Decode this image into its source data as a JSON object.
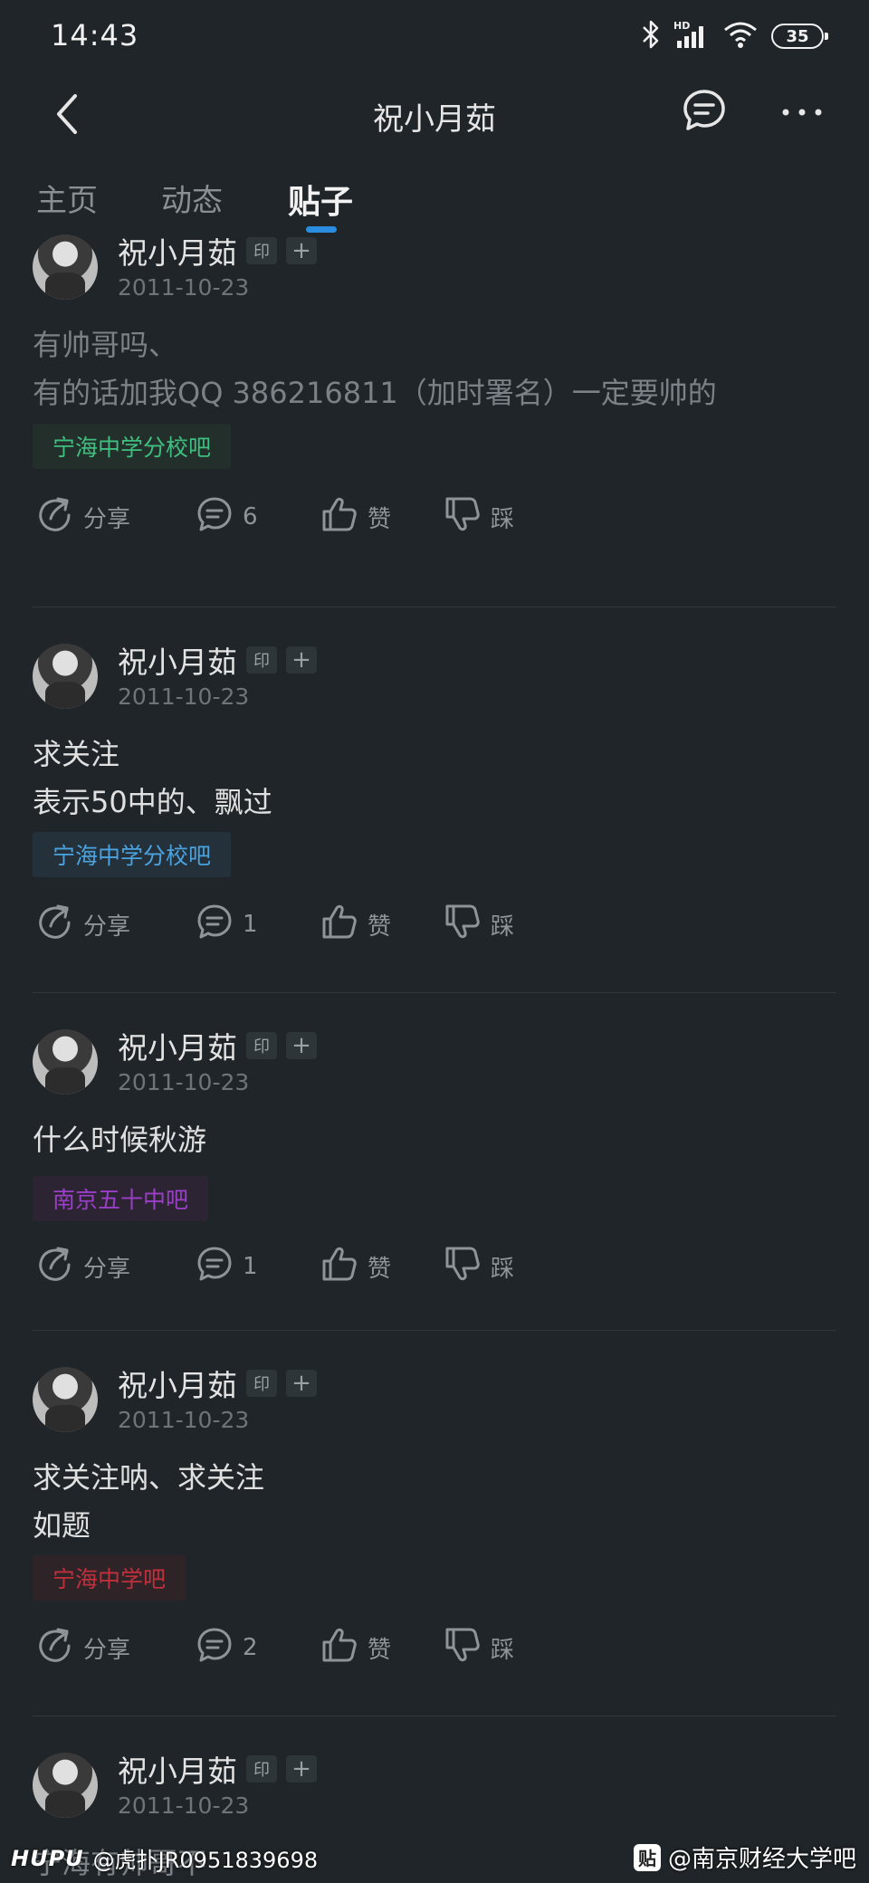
{
  "status_bar": {
    "time": "14:43",
    "battery": "35",
    "icons": [
      "bluetooth-icon",
      "hd-signal-icon",
      "wifi-icon",
      "battery-icon"
    ]
  },
  "header": {
    "title": "祝小月茹"
  },
  "tabs": [
    {
      "label": "主页",
      "active": false
    },
    {
      "label": "动态",
      "active": false
    },
    {
      "label": "贴子",
      "active": true
    }
  ],
  "colors": {
    "background": "#1f2528",
    "accent": "#2a8de0",
    "tag_green": "#3fbf7f",
    "tag_blue": "#4aa3df",
    "tag_purple": "#9b3fc9",
    "tag_red": "#c0303c"
  },
  "badge_label": "印",
  "plus_label": "+",
  "posts": [
    {
      "author": "祝小月茹",
      "date": "2011-10-23",
      "text": "有帅哥吗、\n有的话加我QQ 386216811（加时署名）一定要帅的",
      "dim": true,
      "forum": "宁海中学分校吧",
      "share_label": "分享",
      "comments": "6",
      "like_label": "赞",
      "dislike_label": "踩"
    },
    {
      "author": "祝小月茹",
      "date": "2011-10-23",
      "text": "求关注\n表示50中的、飘过",
      "dim": false,
      "forum": "宁海中学分校吧",
      "share_label": "分享",
      "comments": "1",
      "like_label": "赞",
      "dislike_label": "踩"
    },
    {
      "author": "祝小月茹",
      "date": "2011-10-23",
      "text": "什么时候秋游",
      "dim": false,
      "forum": "南京五十中吧",
      "share_label": "分享",
      "comments": "1",
      "like_label": "赞",
      "dislike_label": "踩"
    },
    {
      "author": "祝小月茹",
      "date": "2011-10-23",
      "text": "求关注呐、求关注\n如题",
      "dim": false,
      "forum": "宁海中学吧",
      "share_label": "分享",
      "comments": "2",
      "like_label": "赞",
      "dislike_label": "踩"
    },
    {
      "author": "祝小月茹",
      "date": "2011-10-23",
      "text": "宁海有帅哥不",
      "dim": true
    }
  ],
  "watermark": {
    "left_logo": "HUPU",
    "left_text": "@虎扑JR0951839698",
    "right_badge": "贴",
    "right_text": "@南京财经大学吧"
  }
}
